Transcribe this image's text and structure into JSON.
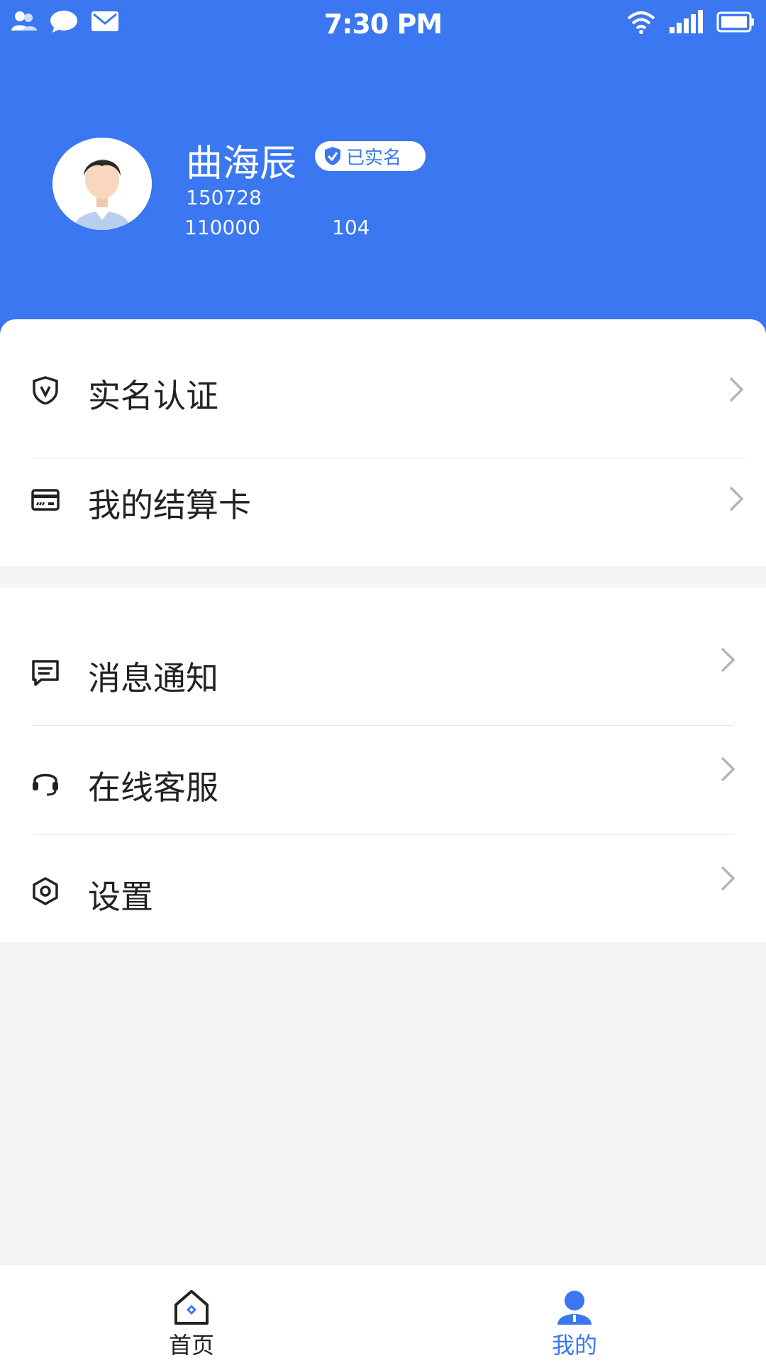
{
  "status_bar": {
    "time": "7:30 PM"
  },
  "profile": {
    "name": "曲海辰",
    "badge": "已实名",
    "phone": "150728",
    "id_prefix": "110000",
    "id_suffix": "104"
  },
  "menu_group_1": [
    {
      "label": "实名认证",
      "icon": "shield-v-icon"
    },
    {
      "label": "我的结算卡",
      "icon": "card-icon"
    }
  ],
  "menu_group_2": [
    {
      "label": "消息通知",
      "icon": "message-icon"
    },
    {
      "label": "在线客服",
      "icon": "headset-icon"
    },
    {
      "label": "设置",
      "icon": "settings-hex-icon"
    }
  ],
  "tabbar": {
    "home_label": "首页",
    "mine_label": "我的",
    "active_color": "#3a77f0",
    "inactive_color": "#222222"
  },
  "colors": {
    "brand": "#3a77f0"
  }
}
